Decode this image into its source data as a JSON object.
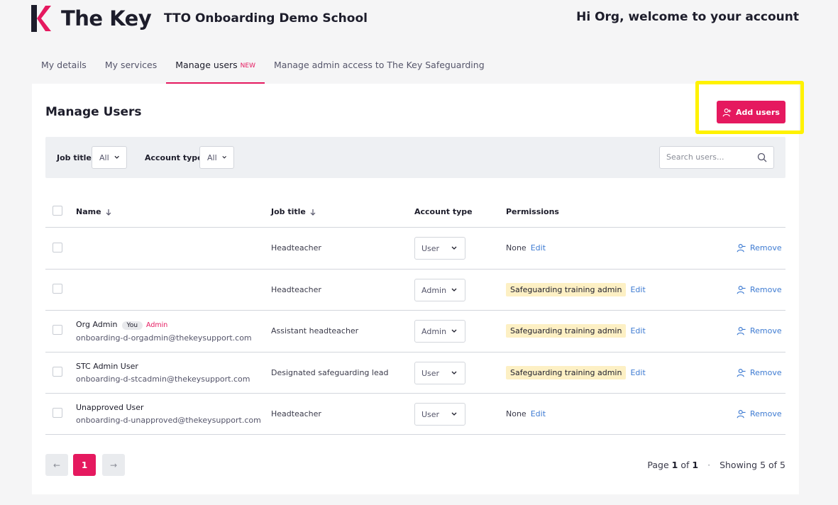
{
  "header": {
    "brand": "The Key",
    "school_name": "TTO Onboarding Demo School",
    "welcome": "Hi Org, welcome to your account"
  },
  "tabs": [
    {
      "label": "My details"
    },
    {
      "label": "My services"
    },
    {
      "label": "Manage users",
      "badge": "NEW",
      "active": true
    },
    {
      "label": "Manage admin access to The Key Safeguarding"
    }
  ],
  "page": {
    "title": "Manage Users",
    "add_button": "Add users"
  },
  "filters": {
    "job_title_label": "Job title",
    "job_title_value": "All",
    "account_type_label": "Account type",
    "account_type_value": "All",
    "search_placeholder": "Search users..."
  },
  "table": {
    "headers": {
      "name": "Name",
      "job_title": "Job title",
      "account_type": "Account type",
      "permissions": "Permissions"
    },
    "rows": [
      {
        "name": "",
        "email": "",
        "job_title": "Headteacher",
        "account_type": "User",
        "permission": "None",
        "permission_badge": false,
        "edit": "Edit",
        "remove": "Remove"
      },
      {
        "name": "",
        "email": "",
        "job_title": "Headteacher",
        "account_type": "Admin",
        "permission": "Safeguarding training admin",
        "permission_badge": true,
        "edit": "Edit",
        "remove": "Remove"
      },
      {
        "name": "Org Admin",
        "you": "You",
        "role_tag": "Admin",
        "email": "onboarding-d-orgadmin@thekeysupport.com",
        "job_title": "Assistant headteacher",
        "account_type": "Admin",
        "permission": "Safeguarding training admin",
        "permission_badge": true,
        "edit": "Edit",
        "remove": "Remove"
      },
      {
        "name": "STC Admin User",
        "email": "onboarding-d-stcadmin@thekeysupport.com",
        "job_title": "Designated safeguarding lead",
        "account_type": "User",
        "permission": "Safeguarding training admin",
        "permission_badge": true,
        "edit": "Edit",
        "remove": "Remove"
      },
      {
        "name": "Unapproved User",
        "email": "onboarding-d-unapproved@thekeysupport.com",
        "job_title": "Headteacher",
        "account_type": "User",
        "permission": "None",
        "permission_badge": false,
        "edit": "Edit",
        "remove": "Remove"
      }
    ]
  },
  "pagination": {
    "prev": "←",
    "current": "1",
    "next": "→",
    "page_prefix": "Page",
    "page_current": "1",
    "page_of": "of",
    "page_total": "1",
    "separator": "·",
    "showing": "Showing 5 of 5"
  },
  "colors": {
    "accent": "#e5195f",
    "link": "#3e7bd2",
    "highlight": "#fff200",
    "badge_bg": "#fdf0c4"
  }
}
